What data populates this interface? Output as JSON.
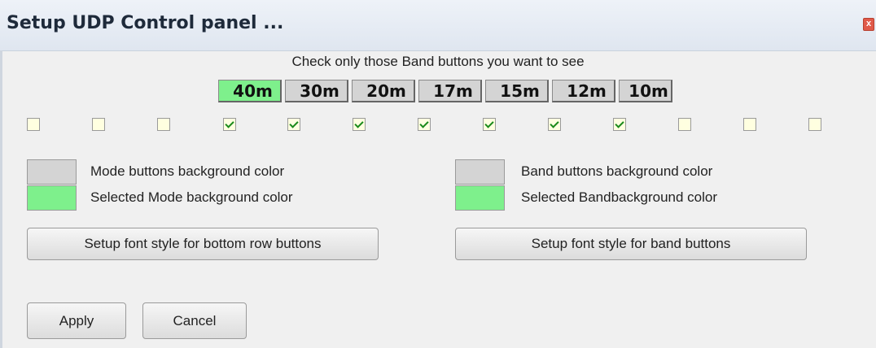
{
  "window": {
    "title": "Setup UDP Control panel ...",
    "close_label": "x"
  },
  "instruction": "Check only those Band buttons you want to see",
  "bands": [
    {
      "label": "40m",
      "selected": true
    },
    {
      "label": "30m",
      "selected": false
    },
    {
      "label": "20m",
      "selected": false
    },
    {
      "label": "17m",
      "selected": false
    },
    {
      "label": "15m",
      "selected": false
    },
    {
      "label": "12m",
      "selected": false
    },
    {
      "label": "10m",
      "selected": false
    }
  ],
  "checkboxes": [
    false,
    false,
    false,
    true,
    true,
    true,
    true,
    true,
    true,
    true,
    false,
    false,
    false
  ],
  "colors": {
    "button_gray": "#d4d4d4",
    "selected_green": "#7ef08c"
  },
  "left_panel": {
    "mode_bg_label": "Mode buttons background color",
    "selected_mode_label": "Selected Mode background color",
    "font_button": "Setup font style for bottom row buttons"
  },
  "right_panel": {
    "band_bg_label": "Band buttons background color",
    "selected_band_label": "Selected Bandbackground color",
    "font_button": "Setup font style for band buttons"
  },
  "actions": {
    "apply": "Apply",
    "cancel": "Cancel"
  }
}
